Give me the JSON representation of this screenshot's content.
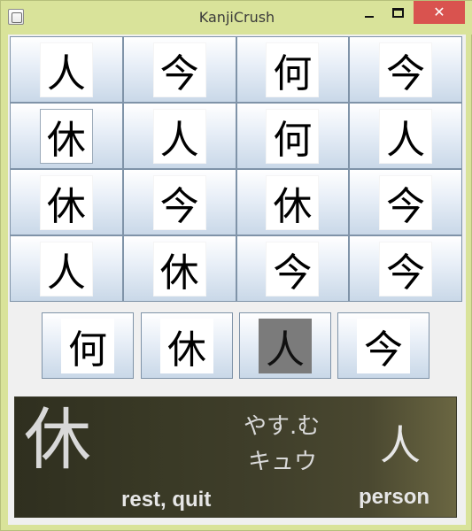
{
  "window": {
    "title": "KanjiCrush",
    "icon": "java-app-icon",
    "controls": {
      "minimize": "minimize-icon",
      "maximize": "maximize-icon",
      "close": "close-icon",
      "close_glyph": "✕"
    }
  },
  "grid": {
    "rows": [
      [
        "人",
        "今",
        "何",
        "今"
      ],
      [
        "休",
        "人",
        "何",
        "人"
      ],
      [
        "休",
        "今",
        "休",
        "今"
      ],
      [
        "人",
        "休",
        "今",
        "今"
      ]
    ]
  },
  "choices": {
    "items": [
      "何",
      "休",
      "人",
      "今"
    ],
    "selected_index": 2
  },
  "info": {
    "kanji": "休",
    "reading_kun": "やす.む",
    "reading_on": "キュウ",
    "meaning": "rest, quit",
    "compare_kanji": "人",
    "compare_meaning": "person"
  }
}
